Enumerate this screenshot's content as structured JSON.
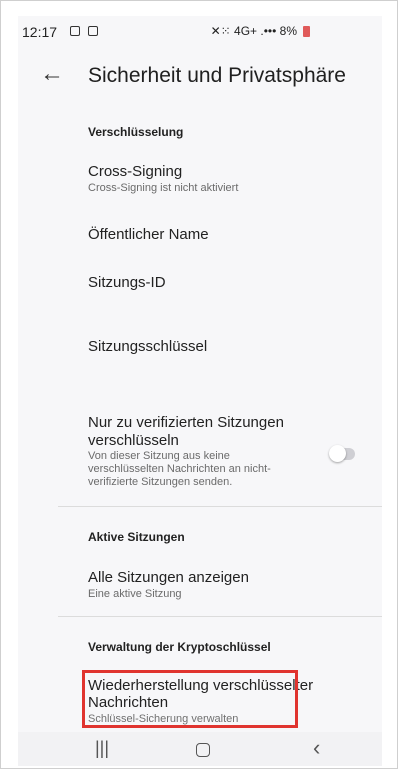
{
  "status_bar": {
    "time": "12:17",
    "right_text": "✕⁙ 4G+ .••• 8%"
  },
  "header": {
    "back_icon": "←",
    "title": "Sicherheit und Privatsphäre"
  },
  "sections": {
    "encryption": {
      "title": "Verschlüsselung",
      "cross_signing_title": "Cross-Signing",
      "cross_signing_sub": "Cross-Signing ist nicht aktiviert",
      "public_name_title": "Öffentlicher Name",
      "session_id_title": "Sitzungs-ID",
      "session_key_title": "Sitzungsschlüssel",
      "verified_only_title": "Nur zu verifizierten Sitzungen verschlüsseln",
      "verified_only_sub": "Von dieser Sitzung aus keine verschlüsselten Nachrichten an nicht-verifizierte Sitzungen senden."
    },
    "active_sessions": {
      "title": "Aktive Sitzungen",
      "show_all_title": "Alle Sitzungen anzeigen",
      "show_all_sub": "Eine aktive Sitzung"
    },
    "crypto_keys": {
      "title": "Verwaltung der Kryptoschlüssel",
      "recovery_title": "Wiederherstellung verschlüsselter Nachrichten",
      "recovery_sub": "Schlüssel-Sicherung verwalten"
    }
  },
  "toggle_state": "off",
  "navbar": {
    "recents_icon": "|||",
    "back_icon": "‹"
  },
  "colors": {
    "highlight": "#e0342f",
    "background": "#f7f7f9",
    "toggle_track": "#cfcfd4"
  }
}
